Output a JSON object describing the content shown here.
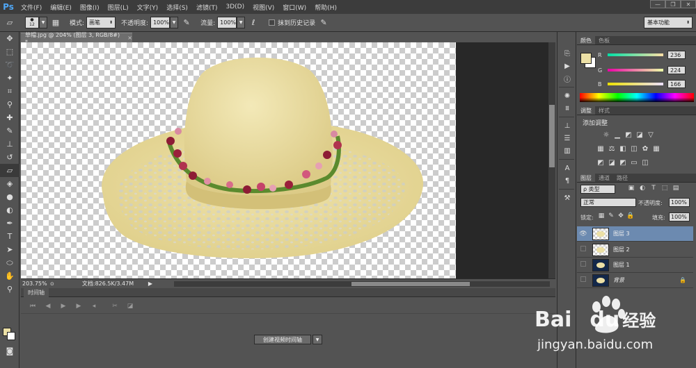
{
  "app": {
    "logo": "Ps"
  },
  "menu": [
    "文件(F)",
    "编辑(E)",
    "图像(I)",
    "图层(L)",
    "文字(Y)",
    "选择(S)",
    "滤镜(T)",
    "3D(D)",
    "视图(V)",
    "窗口(W)",
    "帮助(H)"
  ],
  "window_controls": [
    "—",
    "❐",
    "✕"
  ],
  "options": {
    "brush_size": "12",
    "mode_label": "模式:",
    "mode_value": "画笔",
    "opacity_label": "不透明度:",
    "opacity_value": "100%",
    "flow_label": "流量:",
    "flow_value": "100%",
    "history_label": "抹到历史记录",
    "workspace": "基本功能"
  },
  "document": {
    "tab_title": "草帽.jpg @ 204% (图层 3, RGB/8#) *",
    "close": "×",
    "zoom": "203.75%",
    "doc_size": "文档:826.5K/3.47M"
  },
  "timeline": {
    "tab": "时间轴",
    "create_button": "创建视频时间轴"
  },
  "color_panel": {
    "tabs": [
      "颜色",
      "色板"
    ],
    "r_label": "R",
    "r_value": "236",
    "g_label": "G",
    "g_value": "224",
    "b_label": "B",
    "b_value": "166",
    "fg_color": "#ece0a6"
  },
  "adjust_panel": {
    "tabs": [
      "调整",
      "样式"
    ],
    "title": "添加调整"
  },
  "layers_panel": {
    "tabs": [
      "图层",
      "通道",
      "路径"
    ],
    "filter": "ρ 类型",
    "blend": "正常",
    "opacity_label": "不透明度:",
    "opacity_value": "100%",
    "lock_label": "锁定:",
    "fill_label": "填充:",
    "fill_value": "100%",
    "layers": [
      {
        "name": "图层 3",
        "visible": true,
        "selected": true
      },
      {
        "name": "图层 2",
        "visible": false,
        "selected": false
      },
      {
        "name": "图层 1",
        "visible": false,
        "selected": false
      },
      {
        "name": "背景",
        "visible": false,
        "selected": false
      }
    ]
  },
  "watermark": {
    "brand": "Bai",
    "brand2": "du",
    "cn": "经验",
    "url": "jingyan.baidu.com"
  }
}
